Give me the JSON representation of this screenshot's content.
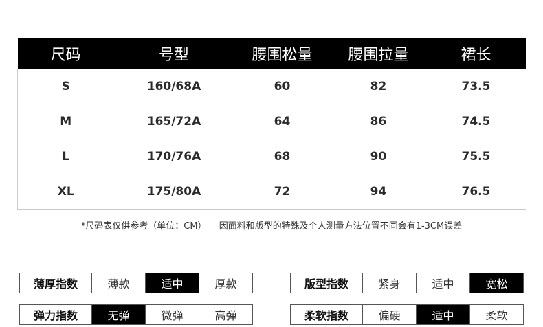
{
  "size_table": {
    "headers": [
      "尺码",
      "号型",
      "腰围松量",
      "腰围拉量",
      "裙长"
    ],
    "rows": [
      [
        "S",
        "160/68A",
        "60",
        "82",
        "73.5"
      ],
      [
        "M",
        "165/72A",
        "64",
        "86",
        "74.5"
      ],
      [
        "L",
        "170/76A",
        "68",
        "90",
        "75.5"
      ],
      [
        "XL",
        "175/80A",
        "72",
        "94",
        "76.5"
      ]
    ]
  },
  "note": {
    "part1": "*尺码表仅供参考（单位：CM）",
    "part2": "因面料和版型的特殊及个人测量方法位置不同会有1-3CM误差"
  },
  "indices": {
    "thickness": {
      "label": "薄厚指数",
      "options": [
        "薄款",
        "适中",
        "厚款"
      ],
      "selected": "适中"
    },
    "fit": {
      "label": "版型指数",
      "options": [
        "紧身",
        "适中",
        "宽松"
      ],
      "selected": "宽松"
    },
    "elastic": {
      "label": "弹力指数",
      "options": [
        "无弹",
        "微弹",
        "高弹"
      ],
      "selected": "无弹"
    },
    "softness": {
      "label": "柔软指数",
      "options": [
        "偏硬",
        "适中",
        "柔软"
      ],
      "selected": "适中"
    }
  },
  "colors": {
    "header_bg": "#000000",
    "active_bg": "#000000",
    "border": "#c9c9c9"
  }
}
